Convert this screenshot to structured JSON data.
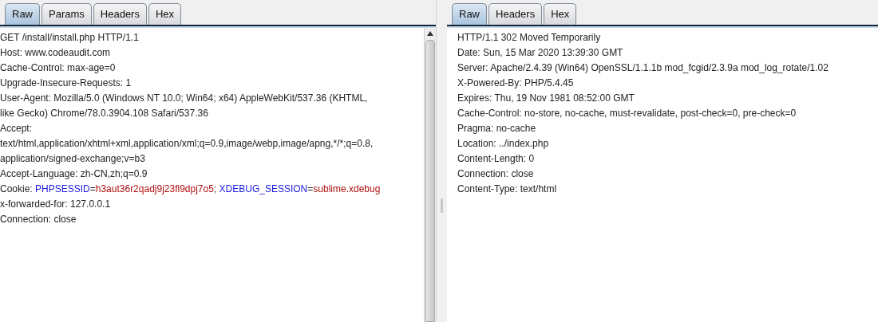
{
  "request": {
    "tabs": [
      {
        "label": "Raw",
        "selected": true
      },
      {
        "label": "Params",
        "selected": false
      },
      {
        "label": "Headers",
        "selected": false
      },
      {
        "label": "Hex",
        "selected": false
      }
    ],
    "lines": [
      [
        {
          "kind": "plain",
          "text": "GET /install/install.php HTTP/1.1"
        }
      ],
      [
        {
          "kind": "plain",
          "text": "Host: www.codeaudit.com"
        }
      ],
      [
        {
          "kind": "plain",
          "text": "Cache-Control: max-age=0"
        }
      ],
      [
        {
          "kind": "plain",
          "text": "Upgrade-Insecure-Requests: 1"
        }
      ],
      [
        {
          "kind": "plain",
          "text": "User-Agent: Mozilla/5.0 (Windows NT 10.0; Win64; x64) AppleWebKit/537.36 (KHTML,"
        }
      ],
      [
        {
          "kind": "plain",
          "text": "like Gecko) Chrome/78.0.3904.108 Safari/537.36"
        }
      ],
      [
        {
          "kind": "plain",
          "text": "Accept:"
        }
      ],
      [
        {
          "kind": "plain",
          "text": "text/html,application/xhtml+xml,application/xml;q=0.9,image/webp,image/apng,*/*;q=0.8,"
        }
      ],
      [
        {
          "kind": "plain",
          "text": "application/signed-exchange;v=b3"
        }
      ],
      [
        {
          "kind": "plain",
          "text": "Accept-Language: zh-CN,zh;q=0.9"
        }
      ],
      [
        {
          "kind": "plain",
          "text": "Cookie: "
        },
        {
          "kind": "name",
          "text": "PHPSESSID"
        },
        {
          "kind": "plain",
          "text": "="
        },
        {
          "kind": "value",
          "text": "h3aut36r2qadj9j23fl9dpj7o5"
        },
        {
          "kind": "plain",
          "text": "; "
        },
        {
          "kind": "name",
          "text": "XDEBUG_SESSION"
        },
        {
          "kind": "plain",
          "text": "="
        },
        {
          "kind": "value",
          "text": "sublime.xdebug"
        }
      ],
      [
        {
          "kind": "plain",
          "text": "x-forwarded-for: 127.0.0.1"
        }
      ],
      [
        {
          "kind": "plain",
          "text": "Connection: close"
        }
      ]
    ]
  },
  "response": {
    "tabs": [
      {
        "label": "Raw",
        "selected": true
      },
      {
        "label": "Headers",
        "selected": false
      },
      {
        "label": "Hex",
        "selected": false
      }
    ],
    "lines": [
      [
        {
          "kind": "plain",
          "text": "HTTP/1.1 302 Moved Temporarily"
        }
      ],
      [
        {
          "kind": "plain",
          "text": "Date: Sun, 15 Mar 2020 13:39:30 GMT"
        }
      ],
      [
        {
          "kind": "plain",
          "text": "Server: Apache/2.4.39 (Win64) OpenSSL/1.1.1b mod_fcgid/2.3.9a mod_log_rotate/1.02"
        }
      ],
      [
        {
          "kind": "plain",
          "text": "X-Powered-By: PHP/5.4.45"
        }
      ],
      [
        {
          "kind": "plain",
          "text": "Expires: Thu, 19 Nov 1981 08:52:00 GMT"
        }
      ],
      [
        {
          "kind": "plain",
          "text": "Cache-Control: no-store, no-cache, must-revalidate, post-check=0, pre-check=0"
        }
      ],
      [
        {
          "kind": "plain",
          "text": "Pragma: no-cache"
        }
      ],
      [
        {
          "kind": "plain",
          "text": "Location: ../index.php"
        }
      ],
      [
        {
          "kind": "plain",
          "text": "Content-Length: 0"
        }
      ],
      [
        {
          "kind": "plain",
          "text": "Connection: close"
        }
      ],
      [
        {
          "kind": "plain",
          "text": "Content-Type: text/html"
        }
      ]
    ]
  }
}
